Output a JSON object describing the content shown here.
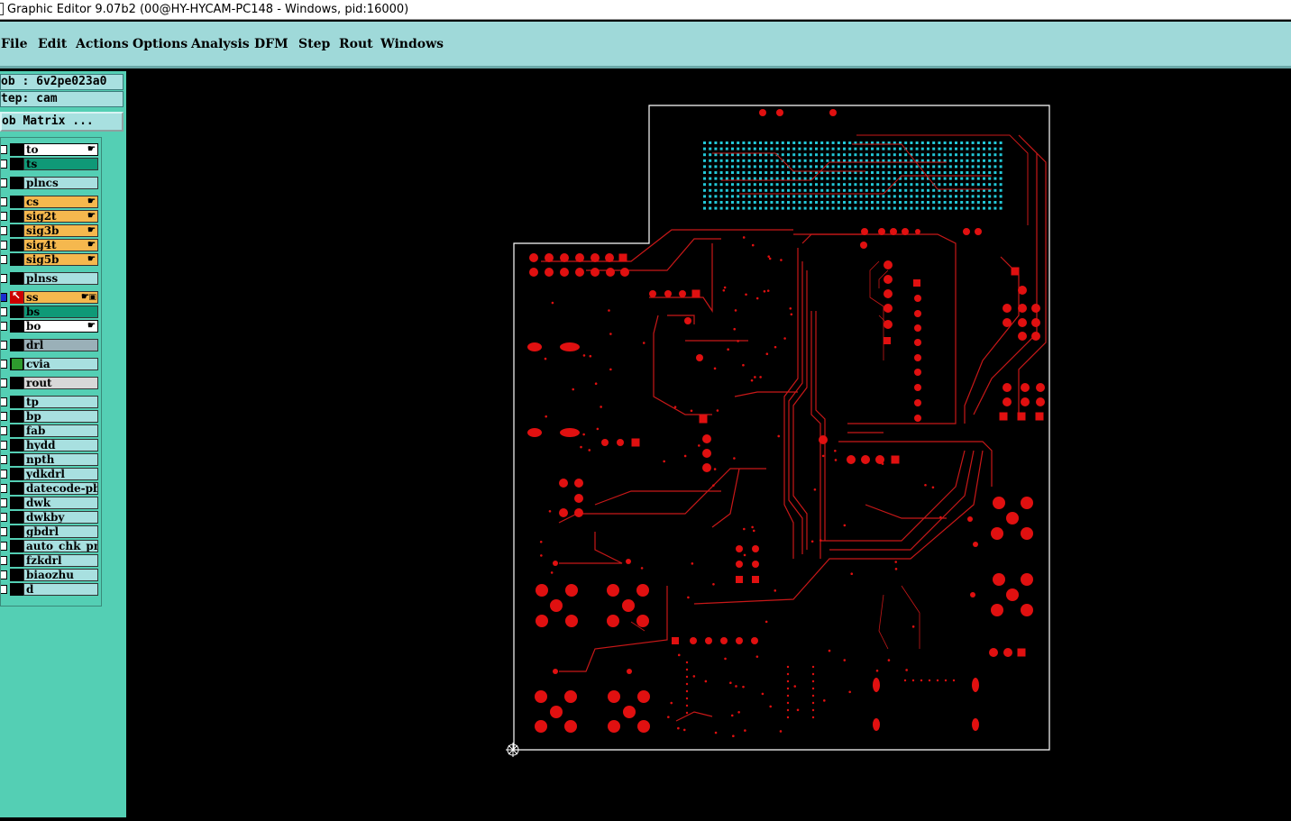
{
  "window": {
    "title": "Graphic Editor 9.07b2 (00@HY-HYCAM-PC148 - Windows, pid:16000)"
  },
  "menu": [
    "File",
    "Edit",
    "Actions",
    "Options",
    "Analysis",
    "DFM",
    "Step",
    "Rout",
    "Windows"
  ],
  "job": {
    "job_label": "ob : 6v2pe023a0",
    "step_label": "tep: cam",
    "matrix_button": "ob Matrix ..."
  },
  "layers": [
    {
      "name": "to",
      "bg": "#ffffff",
      "hand": true
    },
    {
      "name": "ts",
      "bg": "#0f9977",
      "hand": false
    },
    {
      "name": "plncs",
      "bg": "#a8e0e0",
      "hand": false
    },
    {
      "name": "cs",
      "bg": "#f5b84e",
      "hand": true
    },
    {
      "name": "sig2t",
      "bg": "#f5b84e",
      "hand": true
    },
    {
      "name": "sig3b",
      "bg": "#f5b84e",
      "hand": true
    },
    {
      "name": "sig4t",
      "bg": "#f5b84e",
      "hand": true
    },
    {
      "name": "sig5b",
      "bg": "#f5b84e",
      "hand": true
    },
    {
      "name": "plnss",
      "bg": "#a8e0e0",
      "hand": false
    },
    {
      "name": "ss",
      "bg": "#f5b84e",
      "hand": true,
      "active": true
    },
    {
      "name": "bs",
      "bg": "#0f9977",
      "hand": false
    },
    {
      "name": "bo",
      "bg": "#ffffff",
      "hand": true
    },
    {
      "name": "drl",
      "bg": "#9ab0b8",
      "hand": false
    },
    {
      "name": "cvia",
      "bg": "#a8e0e0",
      "hand": false,
      "colorbox": "#2e9a2e"
    },
    {
      "name": "rout",
      "bg": "#d8d8d8",
      "hand": false
    },
    {
      "name": "tp",
      "bg": "#a8e0e0",
      "hand": false
    },
    {
      "name": "bp",
      "bg": "#a8e0e0",
      "hand": false
    },
    {
      "name": "fab",
      "bg": "#a8e0e0",
      "hand": false
    },
    {
      "name": "hydd",
      "bg": "#a8e0e0",
      "hand": false
    },
    {
      "name": "npth",
      "bg": "#a8e0e0",
      "hand": false
    },
    {
      "name": "ydkdrl",
      "bg": "#a8e0e0",
      "hand": false
    },
    {
      "name": "datecode-pbe",
      "bg": "#a8e0e0",
      "hand": false
    },
    {
      "name": "dwk",
      "bg": "#a8e0e0",
      "hand": false
    },
    {
      "name": "dwkby",
      "bg": "#a8e0e0",
      "hand": false
    },
    {
      "name": "gbdrl",
      "bg": "#a8e0e0",
      "hand": false
    },
    {
      "name": "auto_chk_pnl",
      "bg": "#a8e0e0",
      "hand": false
    },
    {
      "name": "fzkdrl",
      "bg": "#a8e0e0",
      "hand": false
    },
    {
      "name": "biaozhu",
      "bg": "#a8e0e0",
      "hand": false
    },
    {
      "name": "d",
      "bg": "#a8e0e0",
      "hand": false
    }
  ],
  "colors": {
    "copper": "#e01010",
    "trace": "#c81818",
    "bga": "#22c8d8",
    "outline": "#ffffff"
  },
  "icons": {
    "hand": "hand-icon",
    "origin": "origin-crosshair-icon",
    "active_arrow": "arrow-icon"
  }
}
